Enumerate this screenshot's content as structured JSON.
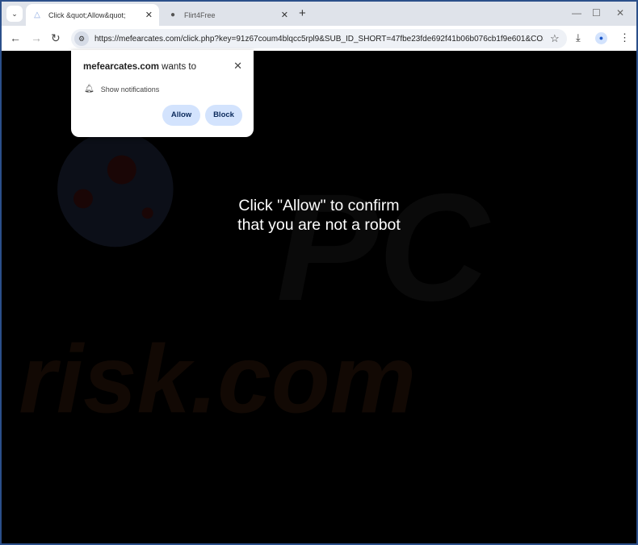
{
  "tabs": [
    {
      "title": "Click &quot;Allow&quot;",
      "icon": "loading-icon",
      "active": true
    },
    {
      "title": "Flirt4Free",
      "icon": "site-favicon",
      "active": false
    }
  ],
  "toolbar": {
    "url": "https://mefearcates.com/click.php?key=91z67coum4blqcc5rpl9&SUB_ID_SHORT=47fbe23fde692f41b06b076cb1f9e601&COS..."
  },
  "popup": {
    "site": "mefearcates.com",
    "wants": " wants to",
    "permission": "Show notifications",
    "allow": "Allow",
    "block": "Block"
  },
  "page": {
    "line1": "Click \"Allow\" to confirm",
    "line2": "that you are not a robot"
  },
  "watermark": {
    "text": "risk.com",
    "logo": "PC"
  },
  "colors": {
    "button_bg": "#d3e3fd",
    "window_border": "#2b4f8a"
  }
}
